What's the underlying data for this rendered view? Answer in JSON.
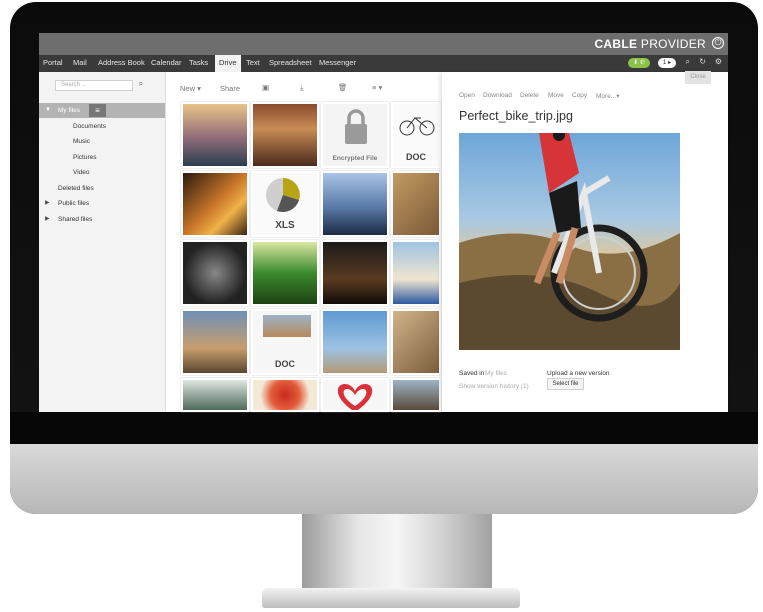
{
  "brand": {
    "name_bold": "CABLE",
    "name_rest": " PROVIDER"
  },
  "nav": {
    "items": [
      "Portal",
      "Mail",
      "Address Book",
      "Calendar",
      "Tasks",
      "Drive",
      "Text",
      "Spreadsheet",
      "Messenger"
    ],
    "active": "Drive",
    "badge_count": "1"
  },
  "sidebar": {
    "search_placeholder": "Search ...",
    "items": [
      "My files",
      "Documents",
      "Music",
      "Pictures",
      "Video",
      "Deleted files",
      "Public files",
      "Shared files"
    ]
  },
  "toolbar": {
    "new": "New",
    "share": "Share"
  },
  "tiles": {
    "encrypted_label": "Encrypted File",
    "doc_label": "DOC",
    "xls_label": "XLS"
  },
  "panel": {
    "close": "Close",
    "actions": [
      "Open",
      "Download",
      "Delete",
      "Move",
      "Copy",
      "More..."
    ],
    "title": "Perfect_bike_trip.jpg",
    "saved_in_label": "Saved in",
    "saved_in_link": "My files",
    "version_history": "Show version history (1)",
    "upload_label": "Upload a new version",
    "select_file": "Select file"
  },
  "colors": {
    "accent_green": "#8bc34a",
    "nav_dark": "#3a3a3a",
    "topbar": "#6e6e6e"
  }
}
